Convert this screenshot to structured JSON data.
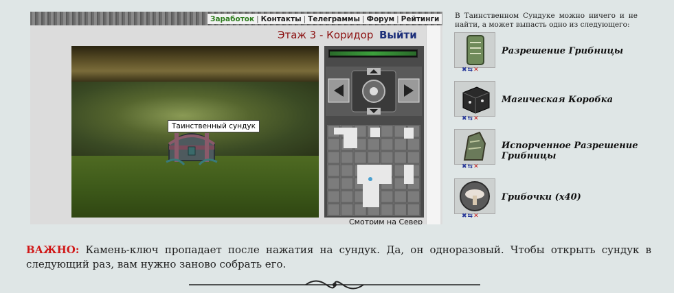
{
  "nav": {
    "items": [
      "Заработок",
      "Контакты",
      "Телеграммы",
      "Форум",
      "Рейтинги"
    ]
  },
  "game": {
    "location": "Этаж 3 - Коридор",
    "exit_label": "Выйти",
    "chest_tooltip": "Таинственный сундук",
    "look_direction": "Смотрим на Север",
    "energy_level": 1.0
  },
  "loot": {
    "intro": "В Таинственном Сундуке можно ничего и не найти, а может выпасть одно из следующего:",
    "items": [
      {
        "name": "Разрешение Грибницы",
        "icon": "permit-scroll-icon"
      },
      {
        "name": "Магическая Коробка",
        "icon": "magic-box-icon"
      },
      {
        "name": "Испорченное Разрешение Грибницы",
        "icon": "spoiled-permit-icon"
      },
      {
        "name": "Грибочки (x40)",
        "icon": "mushrooms-icon"
      }
    ]
  },
  "note": {
    "label": "ВАЖНО:",
    "text": " Камень-ключ пропадает после нажатия на сундук. Да, он одноразовый. Чтобы открыть сундук в следующий раз, вам нужно заново собрать его."
  },
  "colors": {
    "location": "#8b1010",
    "exit": "#1d2f7a",
    "active_nav": "#2e7d1f",
    "important": "#d01818",
    "background": "#dfe6e6"
  }
}
